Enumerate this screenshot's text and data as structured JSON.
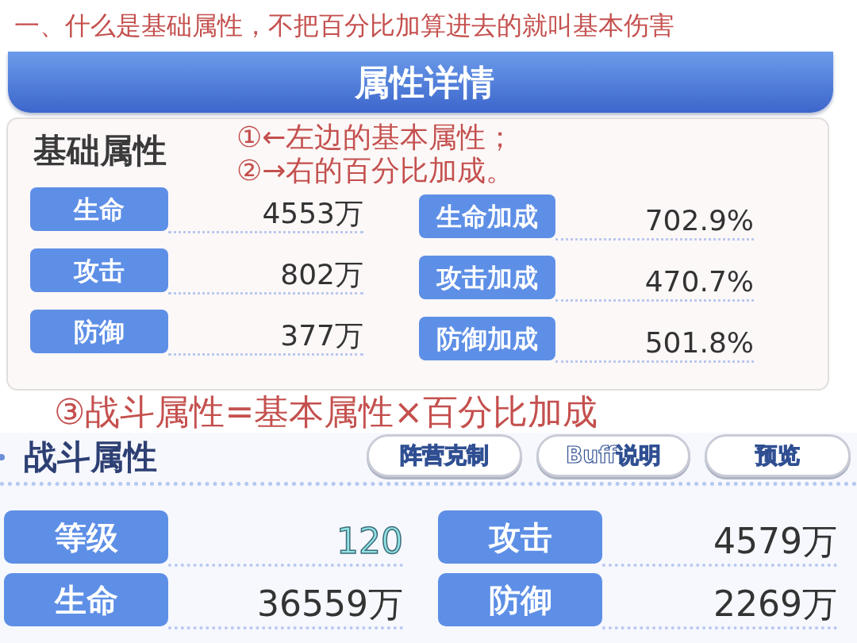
{
  "annotation": "一、什么是基础属性，不把百分比加算进去的就叫基本伤害",
  "header": {
    "title": "属性详情"
  },
  "base_panel": {
    "title": "基础属性",
    "notes": [
      "①←左边的基本属性；",
      "②→右的百分比加成。"
    ],
    "stats": [
      {
        "label": "生命",
        "value": "4553万"
      },
      {
        "label": "攻击",
        "value": "802万"
      },
      {
        "label": "防御",
        "value": "377万"
      }
    ],
    "bonuses": [
      {
        "label": "生命加成",
        "value": "702.9%"
      },
      {
        "label": "攻击加成",
        "value": "470.7%"
      },
      {
        "label": "防御加成",
        "value": "501.8%"
      }
    ]
  },
  "formula_note": "③战斗属性=基本属性×百分比加成",
  "combat_panel": {
    "title": "战斗属性",
    "buttons": [
      "阵营克制",
      "Buff说明",
      "预览"
    ],
    "stats": [
      {
        "label": "等级",
        "value": "120",
        "kind": "level"
      },
      {
        "label": "攻击",
        "value": "4579万",
        "kind": "stat"
      },
      {
        "label": "生命",
        "value": "36559万",
        "kind": "stat"
      },
      {
        "label": "防御",
        "value": "2269万",
        "kind": "stat"
      }
    ]
  }
}
